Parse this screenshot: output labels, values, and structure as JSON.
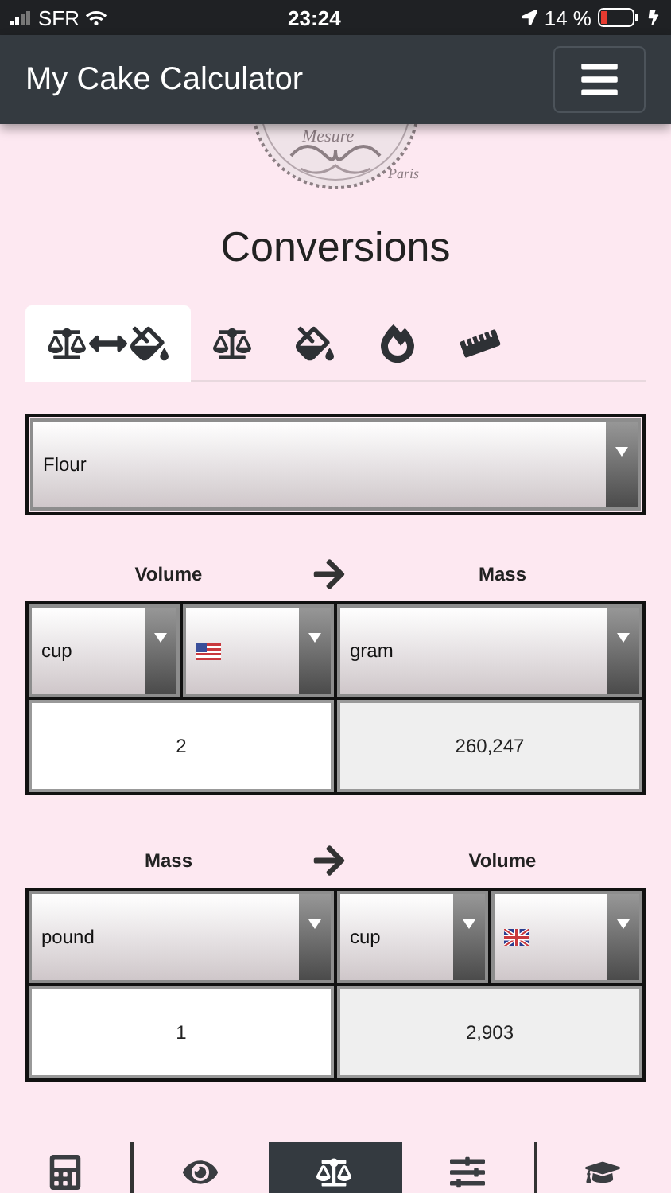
{
  "status_bar": {
    "carrier": "SFR",
    "time": "23:24",
    "battery": "14 %"
  },
  "header": {
    "title": "My Cake Calculator"
  },
  "logo": {
    "texts": [
      "Mesure",
      "Paris"
    ]
  },
  "page_title": "Conversions",
  "tabs": [
    {
      "selected": true
    },
    {
      "selected": false
    },
    {
      "selected": false
    },
    {
      "selected": false
    },
    {
      "selected": false
    }
  ],
  "ingredient": {
    "value": "Flour"
  },
  "conversions": [
    {
      "from_label": "Volume",
      "to_label": "Mass",
      "from_selects": [
        {
          "kind": "unit",
          "value": "cup"
        },
        {
          "kind": "flag"
        }
      ],
      "to_selects": [
        {
          "kind": "unit",
          "value": "gram"
        }
      ],
      "input": "2",
      "output": "260,247"
    },
    {
      "from_label": "Mass",
      "to_label": "Volume",
      "from_selects": [
        {
          "kind": "unit",
          "value": "pound"
        }
      ],
      "to_selects": [
        {
          "kind": "unit",
          "value": "cup"
        },
        {
          "kind": "flag"
        }
      ],
      "input": "1",
      "output": "2,903"
    }
  ],
  "bottom_nav": [
    {
      "selected": false
    },
    {
      "selected": false
    },
    {
      "selected": true
    },
    {
      "selected": false
    },
    {
      "selected": false
    }
  ]
}
